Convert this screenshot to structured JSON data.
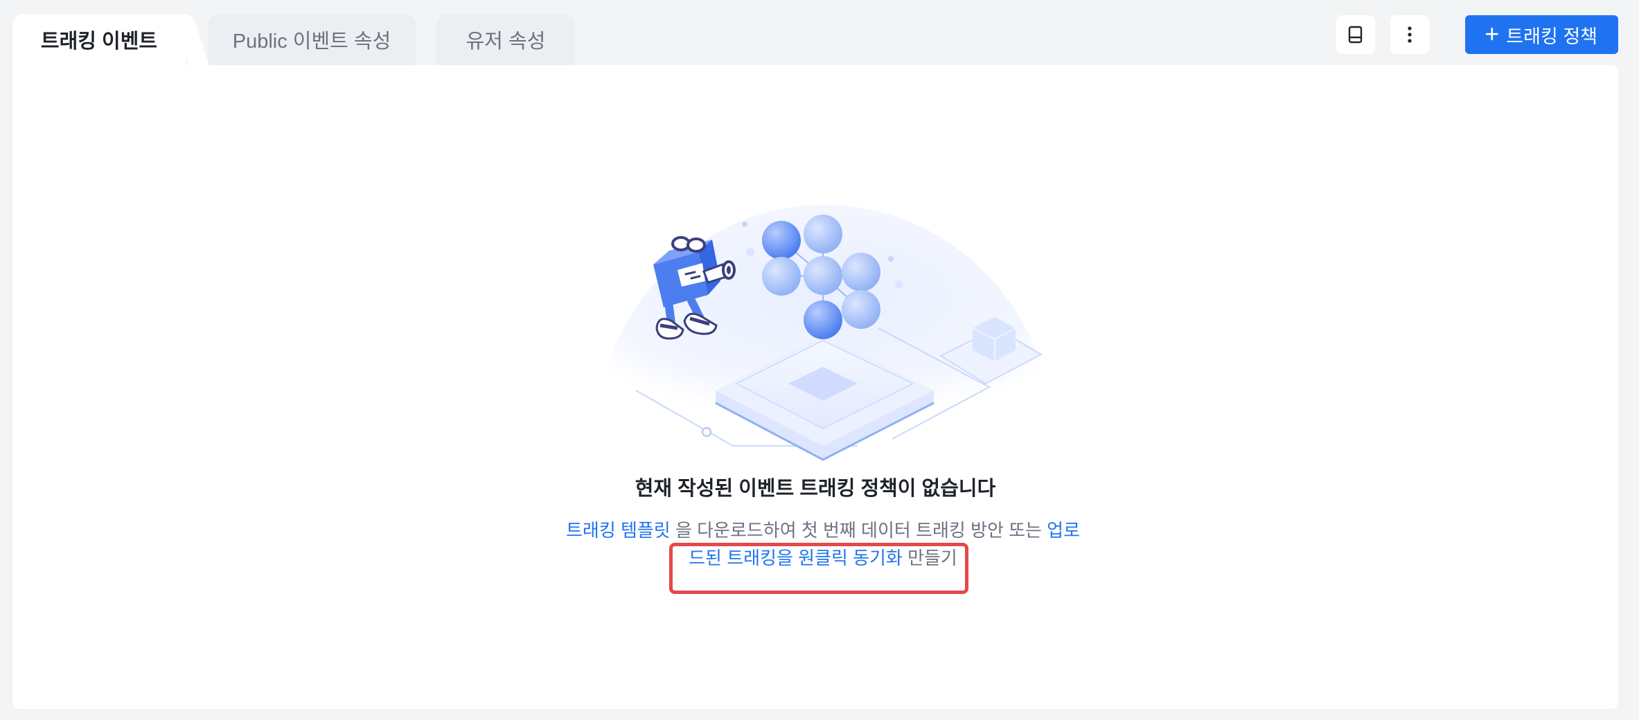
{
  "tabs": [
    {
      "label": "트래킹 이벤트",
      "active": true
    },
    {
      "label": "Public 이벤트 속성",
      "active": false
    },
    {
      "label": "유저 속성",
      "active": false
    }
  ],
  "toolbar": {
    "doc_icon": "book-icon",
    "more_icon": "more-vertical-icon",
    "primary_label": "트래킹 정책",
    "primary_icon": "plus-icon"
  },
  "empty": {
    "title": "현재 작성된 이벤트 트래킹 정책이 없습니다",
    "link_template": "트래킹 템플릿",
    "text_middle": " 을 다운로드하여 첫 번째 데이터 트래킹 방안 또는 ",
    "link_sync": "업로드된 트래킹을 원클릭 동기화",
    "text_end": " 만들기"
  },
  "colors": {
    "accent": "#1f73f1",
    "highlight": "#e5484d",
    "panel": "#ffffff",
    "background": "#f3f4f6"
  }
}
